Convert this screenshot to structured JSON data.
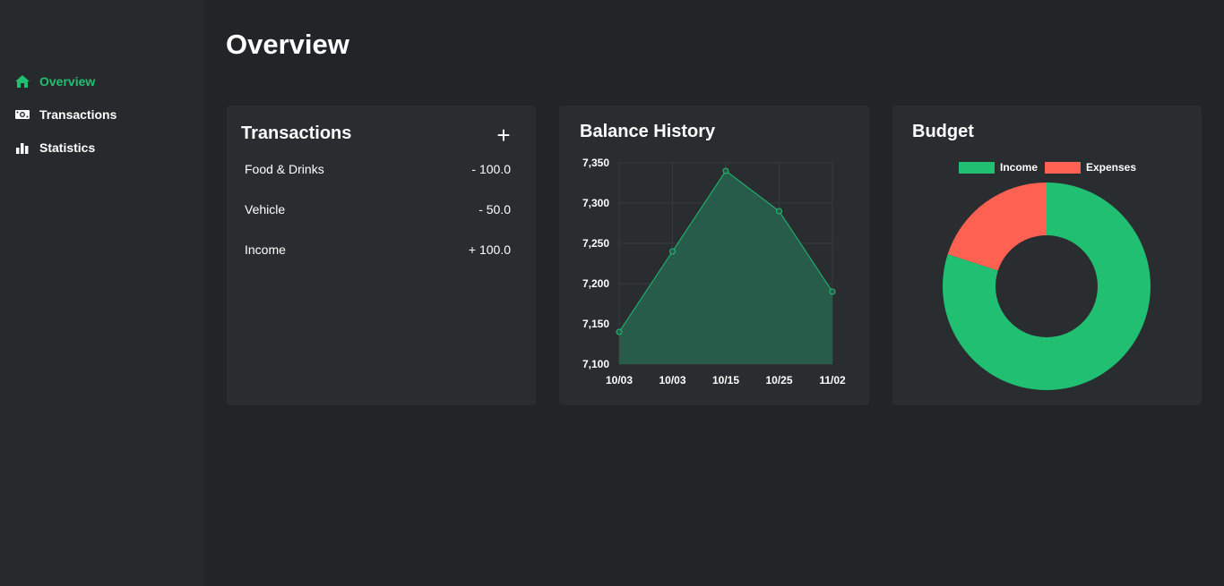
{
  "sidebar": {
    "items": [
      {
        "label": "Overview",
        "icon": "home-icon",
        "active": true
      },
      {
        "label": "Transactions",
        "icon": "money-icon",
        "active": false
      },
      {
        "label": "Statistics",
        "icon": "bar-chart-icon",
        "active": false
      }
    ]
  },
  "page": {
    "title": "Overview"
  },
  "transactions_card": {
    "title": "Transactions",
    "add_label": "+",
    "items": [
      {
        "name": "Food & Drinks",
        "amount": "- 100.0"
      },
      {
        "name": "Vehicle",
        "amount": "- 50.0"
      },
      {
        "name": "Income",
        "amount": "+ 100.0"
      }
    ]
  },
  "balance_card": {
    "title": "Balance History"
  },
  "budget_card": {
    "title": "Budget"
  },
  "colors": {
    "accent": "#20bf72",
    "expense": "#ff6152",
    "area_fill": "#265c49"
  },
  "chart_data": [
    {
      "type": "area",
      "categories": [
        "10/03",
        "10/03",
        "10/15",
        "10/25",
        "11/02"
      ],
      "values": [
        7140,
        7240,
        7340,
        7290,
        7190
      ],
      "ylim": [
        7100,
        7350
      ],
      "yticks": [
        "7,100",
        "7,150",
        "7,200",
        "7,250",
        "7,300",
        "7,350"
      ],
      "grid": true
    },
    {
      "type": "pie",
      "labels": [
        "Income",
        "Expenses"
      ],
      "values": [
        80,
        20
      ],
      "legend": "top"
    }
  ]
}
